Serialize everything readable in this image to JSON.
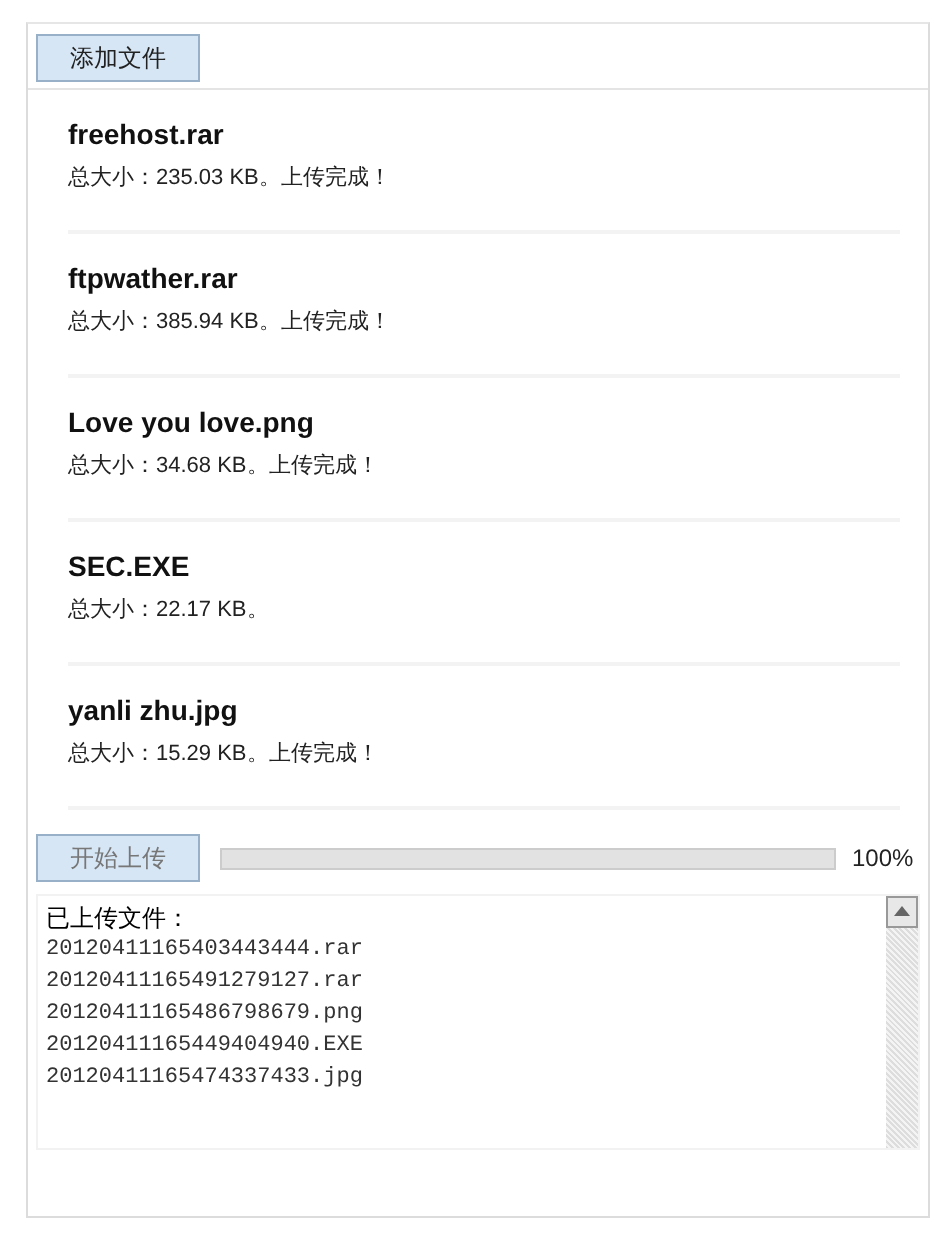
{
  "add_button": "添加文件",
  "files": [
    {
      "name": "freehost.rar",
      "detail": "总大小：235.03 KB。上传完成！"
    },
    {
      "name": "ftpwather.rar",
      "detail": "总大小：385.94 KB。上传完成！"
    },
    {
      "name": "Love you love.png",
      "detail": "总大小：34.68 KB。上传完成！"
    },
    {
      "name": "SEC.EXE",
      "detail": "总大小：22.17 KB。"
    },
    {
      "name": "yanli zhu.jpg",
      "detail": "总大小：15.29 KB。上传完成！"
    }
  ],
  "start_button": {
    "label": "开始上传",
    "disabled": true
  },
  "progress": {
    "level": 1,
    "reading": "100%"
  },
  "log": {
    "title": "已上传文件：",
    "lines": [
      "20120411165403443444.rar",
      "20120411165491279127.rar",
      "20120411165486798679.png",
      "20120411165449404940.EXE",
      "20120411165474337433.jpg"
    ]
  }
}
